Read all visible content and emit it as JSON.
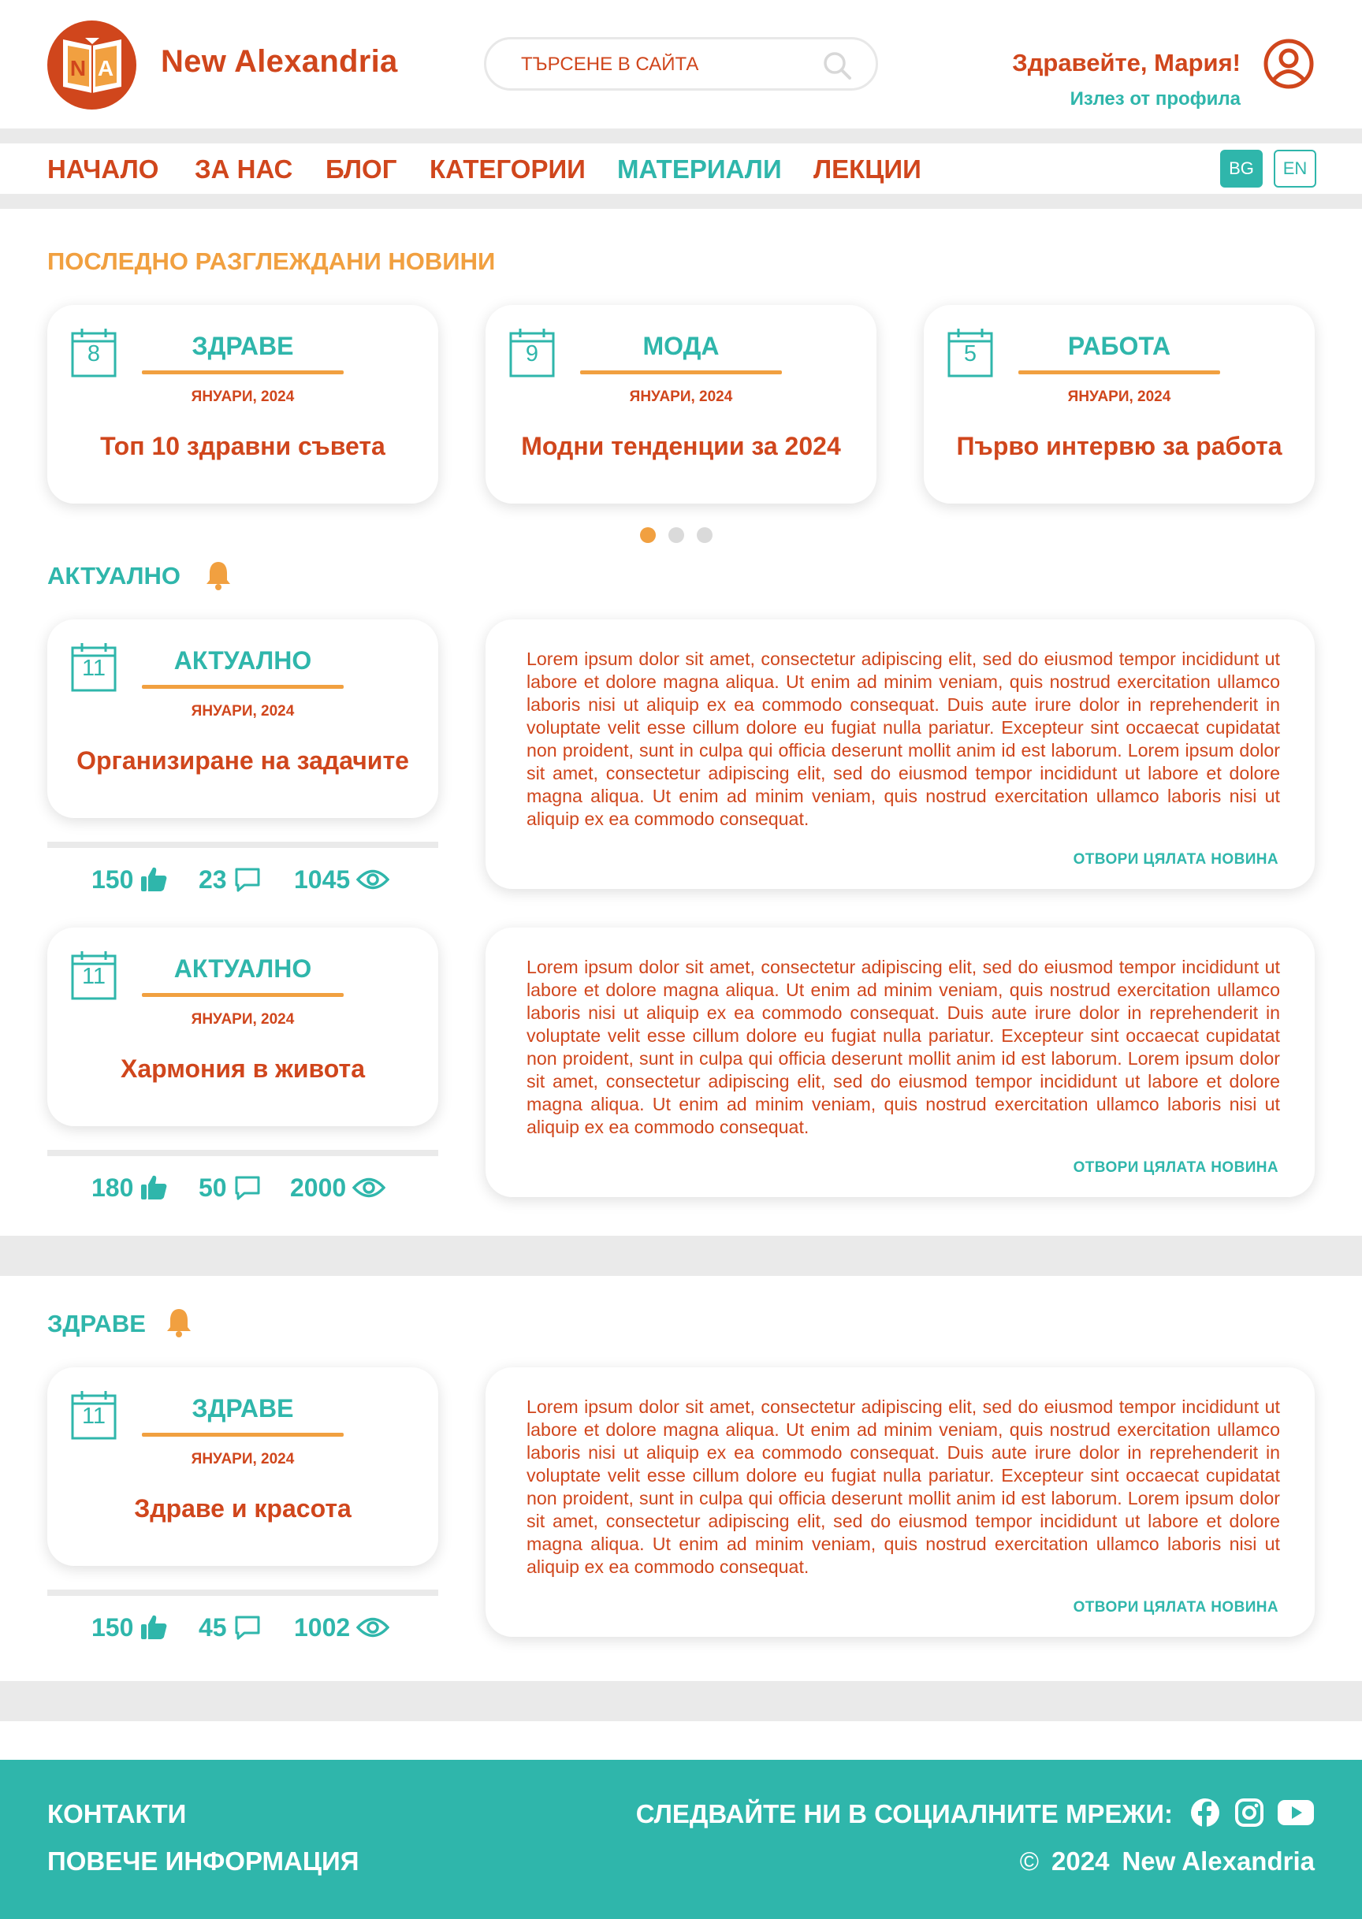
{
  "header": {
    "site_title": "New Alexandria",
    "search_placeholder": "ТЪРСЕНЕ В САЙТА",
    "greeting": "Здравейте, Мария!",
    "logout": "Излез от профила"
  },
  "nav": {
    "items": [
      {
        "label": "НАЧАЛО",
        "active": false
      },
      {
        "label": "ЗА НАС",
        "active": false
      },
      {
        "label": "БЛОГ",
        "active": false
      },
      {
        "label": "КАТЕГОРИИ",
        "active": false
      },
      {
        "label": "МАТЕРИАЛИ",
        "active": true
      },
      {
        "label": "ЛЕКЦИИ",
        "active": false
      }
    ],
    "lang": {
      "bg": "BG",
      "en": "EN",
      "selected": "BG"
    }
  },
  "recent": {
    "title": "ПОСЛЕДНО РАЗГЛЕЖДАНИ НОВИНИ",
    "cards": [
      {
        "day": "8",
        "category": "ЗДРАВЕ",
        "date": "ЯНУАРИ, 2024",
        "headline": "Топ 10 здравни съвета"
      },
      {
        "day": "9",
        "category": "МОДА",
        "date": "ЯНУАРИ, 2024",
        "headline": "Модни тенденции за 2024"
      },
      {
        "day": "5",
        "category": "РАБОТА",
        "date": "ЯНУАРИ, 2024",
        "headline": "Първо интервю за работа"
      }
    ],
    "carousel_pages": 3,
    "carousel_active": 1
  },
  "actual": {
    "title": "АКТУАЛНО",
    "posts": [
      {
        "day": "11",
        "category": "АКТУАЛНО",
        "date": "ЯНУАРИ, 2024",
        "headline": "Организиране на задачите",
        "likes": "150",
        "comments": "23",
        "views": "1045",
        "text": "Lorem ipsum dolor sit amet, consectetur adipiscing elit, sed do eiusmod tempor incididunt ut labore et dolore magna aliqua. Ut enim ad minim veniam, quis nostrud exercitation ullamco laboris nisi ut aliquip ex ea commodo consequat. Duis aute irure dolor in reprehenderit in voluptate velit esse cillum dolore eu fugiat nulla pariatur. Excepteur sint occaecat cupidatat non proident, sunt in culpa qui officia deserunt mollit anim id est laborum. Lorem ipsum dolor sit amet, consectetur adipiscing elit, sed do eiusmod tempor incididunt ut labore et dolore magna aliqua. Ut enim ad minim veniam, quis nostrud exercitation ullamco laboris nisi ut aliquip ex ea commodo consequat.",
        "open_label": "ОТВОРИ ЦЯЛАТА НОВИНА"
      },
      {
        "day": "11",
        "category": "АКТУАЛНО",
        "date": "ЯНУАРИ, 2024",
        "headline": "Хармония в живота",
        "likes": "180",
        "comments": "50",
        "views": "2000",
        "text": "Lorem ipsum dolor sit amet, consectetur adipiscing elit, sed do eiusmod tempor incididunt ut labore et dolore magna aliqua. Ut enim ad minim veniam, quis nostrud exercitation ullamco laboris nisi ut aliquip ex ea commodo consequat. Duis aute irure dolor in reprehenderit in voluptate velit esse cillum dolore eu fugiat nulla pariatur. Excepteur sint occaecat cupidatat non proident, sunt in culpa qui officia deserunt mollit anim id est laborum. Lorem ipsum dolor sit amet, consectetur adipiscing elit, sed do eiusmod tempor incididunt ut labore et dolore magna aliqua. Ut enim ad minim veniam, quis nostrud exercitation ullamco laboris nisi ut aliquip ex ea commodo consequat.",
        "open_label": "ОТВОРИ ЦЯЛАТА НОВИНА"
      }
    ]
  },
  "health": {
    "title": "ЗДРАВЕ",
    "posts": [
      {
        "day": "11",
        "category": "ЗДРАВЕ",
        "date": "ЯНУАРИ, 2024",
        "headline": "Здраве и красота",
        "likes": "150",
        "comments": "45",
        "views": "1002",
        "text": "Lorem ipsum dolor sit amet, consectetur adipiscing elit, sed do eiusmod tempor incididunt ut labore et dolore magna aliqua. Ut enim ad minim veniam, quis nostrud exercitation ullamco laboris nisi ut aliquip ex ea commodo consequat. Duis aute irure dolor in reprehenderit in voluptate velit esse cillum dolore eu fugiat nulla pariatur. Excepteur sint occaecat cupidatat non proident, sunt in culpa qui officia deserunt mollit anim id est laborum. Lorem ipsum dolor sit amet, consectetur adipiscing elit, sed do eiusmod tempor incididunt ut labore et dolore magna aliqua. Ut enim ad minim veniam, quis nostrud exercitation ullamco laboris nisi ut aliquip ex ea commodo consequat.",
        "open_label": "ОТВОРИ ЦЯЛАТА НОВИНА"
      }
    ]
  },
  "footer": {
    "contacts": "КОНТАКТИ",
    "more_info": "ПОВЕЧЕ ИНФОРМАЦИЯ",
    "follow": "СЛЕДВАЙТЕ НИ В СОЦИАЛНИТЕ МРЕЖИ:",
    "copyright_symbol": "©",
    "copyright_year": "2024",
    "copyright_name": "New Alexandria",
    "social": [
      "facebook-icon",
      "instagram-icon",
      "youtube-icon"
    ]
  },
  "colors": {
    "primary": "#d0461c",
    "accent": "#2fb6ab",
    "highlight": "#f1a040",
    "band": "#eaeaea"
  },
  "icons": [
    "book-logo",
    "search-icon",
    "user-icon",
    "calendar-icon",
    "bell-icon",
    "thumbs-up-icon",
    "comment-icon",
    "eye-icon"
  ]
}
